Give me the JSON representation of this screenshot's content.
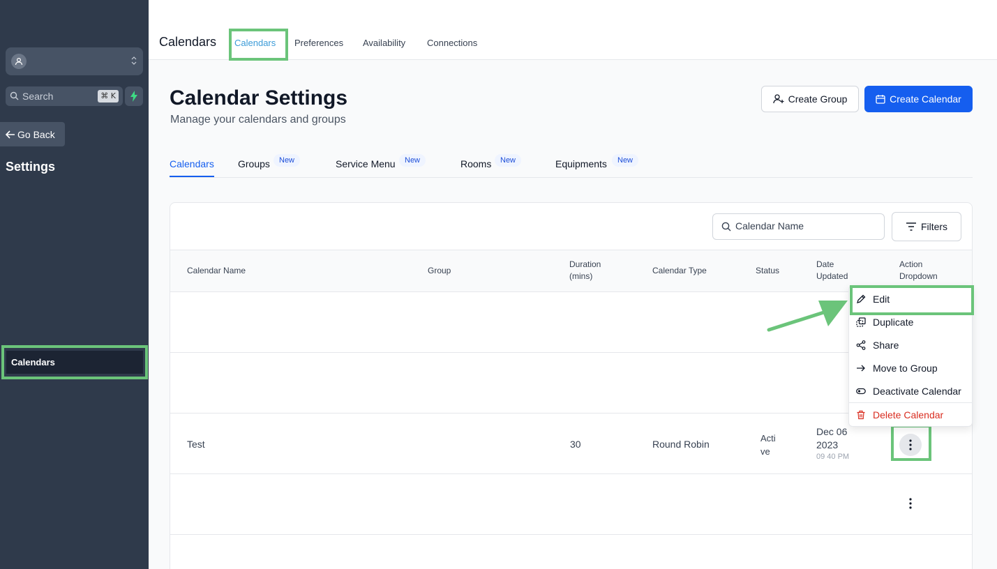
{
  "sidebar": {
    "search_placeholder": "Search",
    "search_shortcut": "⌘ K",
    "go_back": "Go Back",
    "section_title": "Settings",
    "nav_items": [
      {
        "label": "Calendars",
        "active": true
      }
    ]
  },
  "topnav": {
    "title": "Calendars",
    "tabs": [
      {
        "label": "Calendars",
        "active": true
      },
      {
        "label": "Preferences"
      },
      {
        "label": "Availability"
      },
      {
        "label": "Connections"
      }
    ]
  },
  "header": {
    "title": "Calendar Settings",
    "subtitle": "Manage your calendars and groups",
    "create_group": "Create Group",
    "create_calendar": "Create Calendar"
  },
  "subtabs": [
    {
      "label": "Calendars",
      "active": true
    },
    {
      "label": "Groups",
      "badge": "New"
    },
    {
      "label": "Service Menu",
      "badge": "New"
    },
    {
      "label": "Rooms",
      "badge": "New"
    },
    {
      "label": "Equipments",
      "badge": "New"
    }
  ],
  "table": {
    "search_placeholder": "Calendar Name",
    "filters_label": "Filters",
    "columns": {
      "name": "Calendar Name",
      "group": "Group",
      "duration_1": "Duration",
      "duration_2": "(mins)",
      "type": "Calendar Type",
      "status": "Status",
      "date_1": "Date",
      "date_2": "Updated",
      "action_1": "Action",
      "action_2": "Dropdown"
    },
    "rows": [
      {
        "name": "",
        "group": "",
        "duration": "",
        "type": "",
        "status": "",
        "date": "",
        "time": ""
      },
      {
        "name": "",
        "group": "",
        "duration": "",
        "type": "",
        "status": "",
        "date": "",
        "time": ""
      },
      {
        "name": "Test",
        "group": "",
        "duration": "30",
        "type": "Round Robin",
        "status_1": "Acti",
        "status_2": "ve",
        "date_1": "Dec 06",
        "date_2": "2023",
        "time": "09 40 PM"
      },
      {
        "name": "",
        "group": "",
        "duration": "",
        "type": "",
        "status": "",
        "date": "",
        "time": ""
      }
    ]
  },
  "action_menu": {
    "items": [
      {
        "label": "Edit",
        "icon": "pencil-icon"
      },
      {
        "label": "Duplicate",
        "icon": "copy-icon"
      },
      {
        "label": "Share",
        "icon": "share-icon"
      },
      {
        "label": "Move to Group",
        "icon": "arrow-right-icon"
      },
      {
        "label": "Deactivate Calendar",
        "icon": "toggle-icon"
      },
      {
        "label": "Delete Calendar",
        "icon": "trash-icon",
        "danger": true
      }
    ]
  },
  "colors": {
    "sidebar_bg": "#2f3a4b",
    "primary": "#155eef",
    "highlight": "#6bc47a",
    "danger": "#d92d20"
  }
}
